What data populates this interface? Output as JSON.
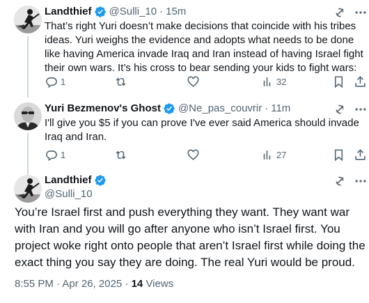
{
  "tweets": [
    {
      "name": "Landthief",
      "handle": "@Sulli_10",
      "time": "15m",
      "text": "That’s right Yuri doesn’t make decisions that coincide with his tribes ideas. Yuri weighs the evidence and adopts what needs to be done like having America invade Iraq and Iran instead of having Israel fight their own wars. It’s his cross to bear sending your kids to fight wars:",
      "replies": "1",
      "views": "32"
    },
    {
      "name": "Yuri Bezmenov's Ghost",
      "handle": "@Ne_pas_couvrir",
      "time": "11m",
      "text": "I'll give you $5 if you can prove I've ever said America should invade Iraq and Iran.",
      "replies": "1",
      "views": "27"
    }
  ],
  "main": {
    "name": "Landthief",
    "handle": "@Sulli_10",
    "text": "You’re Israel first and push everything they want. They want war with Iran and you will go after anyone who isn’t Israel first. You project woke right onto people that aren’t Israel first while doing the exact thing you say they are doing. The real Yuri would be proud.",
    "timestamp": "8:55 PM · Apr 26, 2025 · ",
    "views_count": "14",
    "views_label": " Views"
  },
  "icons": {
    "verified": "verified-badge-icon",
    "grok": "grok-icon",
    "more": "more-icon",
    "reply": "reply-icon",
    "retweet": "retweet-icon",
    "like": "like-icon",
    "views": "views-icon",
    "bookmark": "bookmark-icon",
    "share": "share-icon"
  },
  "colors": {
    "text": "#0f1419",
    "secondary": "#536471",
    "verified": "#1d9bf0",
    "thread_line": "#cfd9de"
  }
}
